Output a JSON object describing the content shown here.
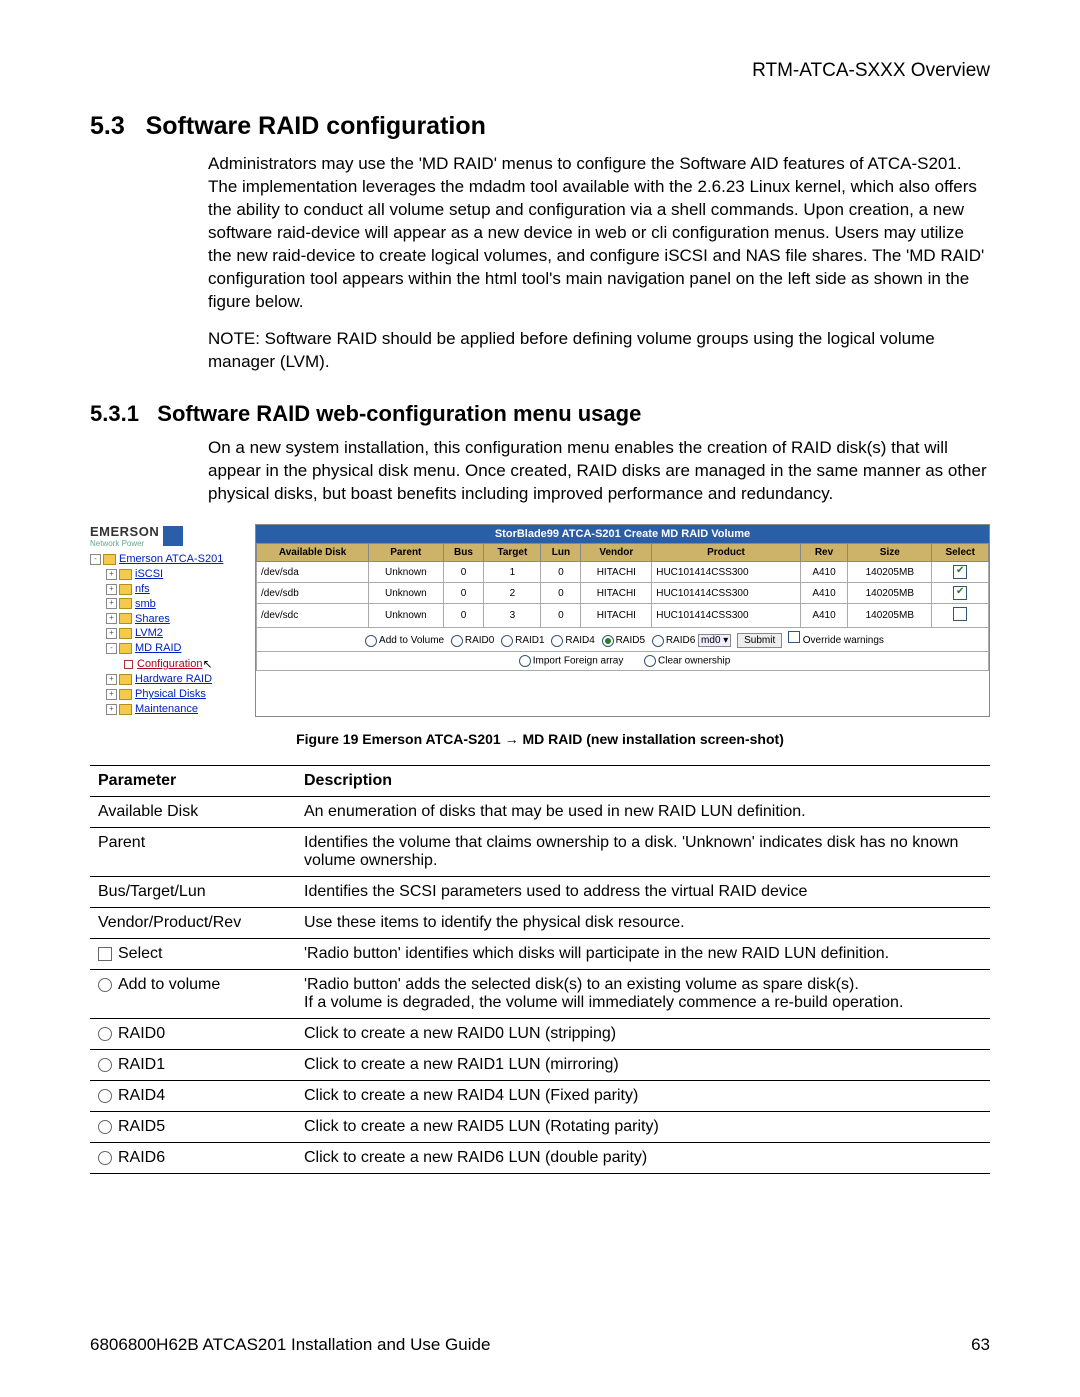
{
  "header": {
    "overview": "RTM-ATCA-SXXX Overview"
  },
  "sec53": {
    "num": "5.3",
    "title": "Software RAID configuration",
    "p1": "Administrators may use the 'MD RAID' menus to configure the Software AID features of ATCA-S201.  The implementation leverages the mdadm tool available with the 2.6.23 Linux kernel, which also offers the ability to conduct all volume setup and configuration via a shell commands.  Upon creation, a new software raid-device will appear as a new device in web or cli configuration menus. Users may utilize the new raid-device to create logical volumes, and configure iSCSI and NAS file shares. The 'MD RAID' configuration tool appears within the html tool's main navigation panel on the left side as shown in the figure below.",
    "p2": "NOTE: Software RAID should be applied before defining volume groups using the logical volume manager (LVM)."
  },
  "sec531": {
    "num": "5.3.1",
    "title": "Software RAID web-configuration menu usage",
    "p1": "On a new system installation, this configuration menu enables the creation of RAID disk(s) that will appear in the physical disk menu.  Once created, RAID disks are managed in the same manner as other physical disks, but boast benefits including improved performance and redundancy."
  },
  "figure": {
    "brand": "EMERSON",
    "brand_sub": "Network Power",
    "tree": {
      "root": "Emerson ATCA-S201",
      "items": [
        "iSCSI",
        "nfs",
        "smb",
        "Shares",
        "LVM2",
        "MD RAID",
        "Configuration",
        "Hardware RAID",
        "Physical Disks",
        "Maintenance"
      ]
    },
    "panel_title": "StorBlade99 ATCA-S201 Create MD RAID Volume",
    "cols": [
      "Available Disk",
      "Parent",
      "Bus",
      "Target",
      "Lun",
      "Vendor",
      "Product",
      "Rev",
      "Size",
      "Select"
    ],
    "rows": [
      {
        "disk": "/dev/sda",
        "parent": "Unknown",
        "bus": "0",
        "target": "1",
        "lun": "0",
        "vendor": "HITACHI",
        "product": "HUC101414CSS300",
        "rev": "A410",
        "size": "140205MB",
        "sel": true
      },
      {
        "disk": "/dev/sdb",
        "parent": "Unknown",
        "bus": "0",
        "target": "2",
        "lun": "0",
        "vendor": "HITACHI",
        "product": "HUC101414CSS300",
        "rev": "A410",
        "size": "140205MB",
        "sel": true
      },
      {
        "disk": "/dev/sdc",
        "parent": "Unknown",
        "bus": "0",
        "target": "3",
        "lun": "0",
        "vendor": "HITACHI",
        "product": "HUC101414CSS300",
        "rev": "A410",
        "size": "140205MB",
        "sel": false
      }
    ],
    "ctrl": {
      "add": "Add to Volume",
      "r0": "RAID0",
      "r1": "RAID1",
      "r4": "RAID4",
      "r5": "RAID5",
      "r6": "RAID6",
      "md": "md0",
      "submit": "Submit",
      "override": "Override warnings",
      "import": "Import Foreign array",
      "clear": "Clear ownership"
    },
    "caption": "Figure 19  Emerson ATCA-S201 → MD RAID (new installation screen-shot)"
  },
  "paramTable": {
    "h1": "Parameter",
    "h2": "Description",
    "rows": [
      {
        "p": "Available Disk",
        "d": "An enumeration of disks that may be used in new RAID LUN definition.",
        "icon": ""
      },
      {
        "p": "Parent",
        "d": "Identifies the volume that claims ownership to a disk. 'Unknown' indicates disk has no known volume ownership.",
        "icon": ""
      },
      {
        "p": "Bus/Target/Lun",
        "d": "Identifies the SCSI parameters used to address the virtual RAID device",
        "icon": ""
      },
      {
        "p": "Vendor/Product/Rev",
        "d": "Use these items to identify the physical disk resource.",
        "icon": ""
      },
      {
        "p": "Select",
        "d": "'Radio button' identifies which disks will participate in the new RAID LUN definition.",
        "icon": "sq"
      },
      {
        "p": "Add to volume",
        "d": "'Radio button' adds the selected disk(s) to an existing volume as spare disk(s).\nIf a volume is degraded, the volume will immediately commence a re-build operation.",
        "icon": "rad"
      },
      {
        "p": "RAID0",
        "d": "Click to create a new RAID0 LUN (stripping)",
        "icon": "rad"
      },
      {
        "p": "RAID1",
        "d": "Click to create a new RAID1 LUN (mirroring)",
        "icon": "rad"
      },
      {
        "p": "RAID4",
        "d": "Click to create a new RAID4 LUN (Fixed parity)",
        "icon": "rad"
      },
      {
        "p": "RAID5",
        "d": "Click to create a new RAID5 LUN (Rotating parity)",
        "icon": "rad"
      },
      {
        "p": "RAID6",
        "d": "Click to create a new RAID6 LUN (double parity)",
        "icon": "rad"
      }
    ]
  },
  "footer": {
    "left": "6806800H62B ATCAS201 Installation and Use Guide",
    "right": "63"
  }
}
